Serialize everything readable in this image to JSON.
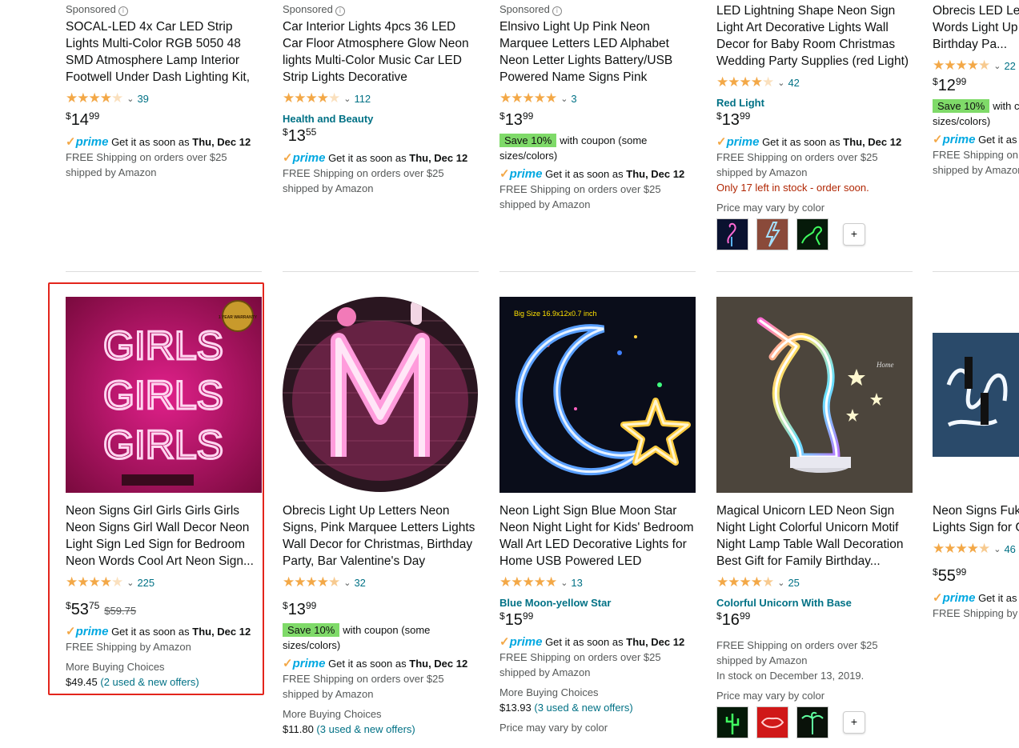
{
  "top_row": [
    {
      "sponsored": "Sponsored",
      "title": "SOCAL-LED 4x Car LED Strip Lights Multi-Color RGB 5050 48 SMD Atmosphere Lamp Interior Footwell Under Dash Lighting Kit, Wireless...",
      "rating_count": "39",
      "rating": 4.0,
      "price_whole": "14",
      "price_frac": "99",
      "prime_text": "Get it as soon as",
      "delivery_date": "Thu, Dec 12",
      "ship1": "FREE Shipping on orders over $25",
      "ship2": "shipped by Amazon"
    },
    {
      "sponsored": "Sponsored",
      "title": "Car Interior Lights 4pcs 36 LED Car Floor Atmosphere Glow Neon lights Multi-Color Music Car LED Strip Lights Decorative Underdash...",
      "rating_count": "112",
      "rating": 4.0,
      "variant": "Health and Beauty",
      "price_whole": "13",
      "price_frac": "55",
      "prime_text": "Get it as soon as",
      "delivery_date": "Thu, Dec 12",
      "ship1": "FREE Shipping on orders over $25",
      "ship2": "shipped by Amazon"
    },
    {
      "sponsored": "Sponsored",
      "title": "Elnsivo Light Up Pink Neon Marquee Letters LED Alphabet Neon Letter Lights Battery/USB Powered Name Signs Pink Words...",
      "rating_count": "3",
      "rating": 5.0,
      "price_whole": "13",
      "price_frac": "99",
      "coupon_badge": "Save 10%",
      "coupon_text": "with coupon (some sizes/colors)",
      "prime_text": "Get it as soon as",
      "delivery_date": "Thu, Dec 12",
      "ship1": "FREE Shipping on orders over $25",
      "ship2": "shipped by Amazon"
    },
    {
      "title": "LED Lightning Shape Neon Sign Light Art Decorative Lights Wall Decor for Baby Room Christmas Wedding Party Supplies (red Light)",
      "rating_count": "42",
      "rating": 4.0,
      "variant": "Red Light",
      "price_whole": "13",
      "price_frac": "99",
      "prime_text": "Get it as soon as",
      "delivery_date": "Thu, Dec 12",
      "ship1": "FREE Shipping on orders over $25",
      "ship2": "shipped by Amazon",
      "stock": "Only 17 left in stock - order soon.",
      "price_vary": "Price may vary by color",
      "plus": "+"
    },
    {
      "title": "Obrecis LED Letter Lights Alphabet Words Light Up Letters Wall, Birthday Pa...",
      "rating_count": "22",
      "rating": 4.5,
      "price_whole": "12",
      "price_frac": "99",
      "coupon_badge": "Save 10%",
      "coupon_text": "with coupon (some sizes/colors)",
      "prime_text": "Get it as",
      "delivery_date": "",
      "ship1": "FREE Shipping on",
      "ship2": "shipped by Amazon"
    }
  ],
  "bottom_row": [
    {
      "title": "Neon Signs Girl Girls Girls Girls Neon Signs Girl Wall Decor Neon Light Sign Led Sign for Bedroom Neon Words Cool Art Neon Sign...",
      "rating_count": "225",
      "rating": 4.0,
      "price_whole": "53",
      "price_frac": "75",
      "was_price": "$59.75",
      "prime_text": "Get it as soon as",
      "delivery_date": "Thu, Dec 12",
      "ship1": "FREE Shipping by Amazon",
      "mbc_label": "More Buying Choices",
      "mbc_price": "$49.45",
      "mbc_offers": "(2 used & new offers)",
      "image_text": [
        "GIRLS",
        "GIRLS",
        "GIRLS"
      ],
      "badge_text": "1 YEAR WARRANTY"
    },
    {
      "title": "Obrecis Light Up Letters Neon Signs, Pink Marquee Letters Lights Wall Decor for Christmas, Birthday Party, Bar Valentine's Day Words-...",
      "rating_count": "32",
      "rating": 4.5,
      "price_whole": "13",
      "price_frac": "99",
      "coupon_badge": "Save 10%",
      "coupon_text": "with coupon (some sizes/colors)",
      "prime_text": "Get it as soon as",
      "delivery_date": "Thu, Dec 12",
      "ship1": "FREE Shipping on orders over $25",
      "ship2": "shipped by Amazon",
      "mbc_label": "More Buying Choices",
      "mbc_price": "$11.80",
      "mbc_offers": "(3 used & new offers)"
    },
    {
      "title": "Neon Light Sign Blue Moon Star Neon Night Light for Kids' Bedroom Wall Art LED Decorative Lights for Home USB Powered LED Crescent...",
      "rating_count": "13",
      "rating": 5.0,
      "variant": "Blue Moon-yellow Star",
      "price_whole": "15",
      "price_frac": "99",
      "prime_text": "Get it as soon as",
      "delivery_date": "Thu, Dec 12",
      "ship1": "FREE Shipping on orders over $25",
      "ship2": "shipped by Amazon",
      "mbc_label": "More Buying Choices",
      "mbc_price": "$13.93",
      "mbc_offers": "(3 used & new offers)",
      "price_vary": "Price may vary by color",
      "image_text": "Big Size  16.9x12x0.7 inch"
    },
    {
      "title": "Magical Unicorn LED Neon Sign Night Light Colorful Unicorn Motif Night Lamp Table Wall Decoration Best Gift for Family Birthday...",
      "rating_count": "25",
      "rating": 4.5,
      "variant": "Colorful Unicorn With Base",
      "price_whole": "16",
      "price_frac": "99",
      "ship1": "FREE Shipping on orders over $25",
      "ship2": "shipped by Amazon",
      "stock_note": "In stock on December 13, 2019.",
      "price_vary": "Price may vary by color",
      "plus": "+",
      "image_text": "Home"
    },
    {
      "title": "Neon Signs Fuki Light White Han Lights Sign for G Hotel Bar Party",
      "rating_count": "46",
      "rating": 4.5,
      "price_whole": "55",
      "price_frac": "99",
      "prime_text": "Get it as",
      "ship1": "FREE Shipping by A"
    }
  ],
  "prime_label": "prime",
  "currency": "$",
  "colors": {
    "link": "#007185",
    "star": "#f3a847",
    "prime": "#00a8e1",
    "coupon": "#7fda69",
    "deal_red": "#b12704",
    "highlight": "#e3251c"
  }
}
